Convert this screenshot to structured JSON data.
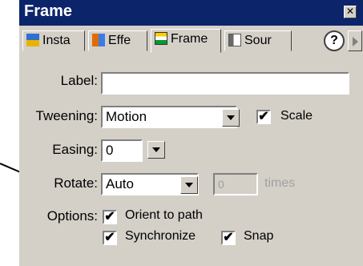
{
  "panel": {
    "title": "Frame",
    "close_symbol": "✕",
    "tabs": [
      {
        "label": "Insta",
        "icon": "instance-icon"
      },
      {
        "label": "Effe",
        "icon": "effect-icon"
      },
      {
        "label": "Frame",
        "icon": "frame-icon"
      },
      {
        "label": "Sour",
        "icon": "sound-icon"
      }
    ],
    "help_symbol": "?"
  },
  "form": {
    "label": {
      "caption": "Label:",
      "value": ""
    },
    "tweening": {
      "caption": "Tweening:",
      "value": "Motion",
      "scale_label": "Scale",
      "scale_checked": true
    },
    "easing": {
      "caption": "Easing:",
      "value": "0"
    },
    "rotate": {
      "caption": "Rotate:",
      "value": "Auto",
      "times_value": "0",
      "times_label": "times"
    },
    "options": {
      "caption": "Options:",
      "orient_label": "Orient to path",
      "orient_checked": true,
      "sync_label": "Synchronize",
      "sync_checked": true,
      "snap_label": "Snap",
      "snap_checked": true
    }
  },
  "check_mark": "✔",
  "colors": {
    "title_bar": "#0b246a",
    "panel": "#d4d0c8",
    "arrow": "#000000"
  }
}
